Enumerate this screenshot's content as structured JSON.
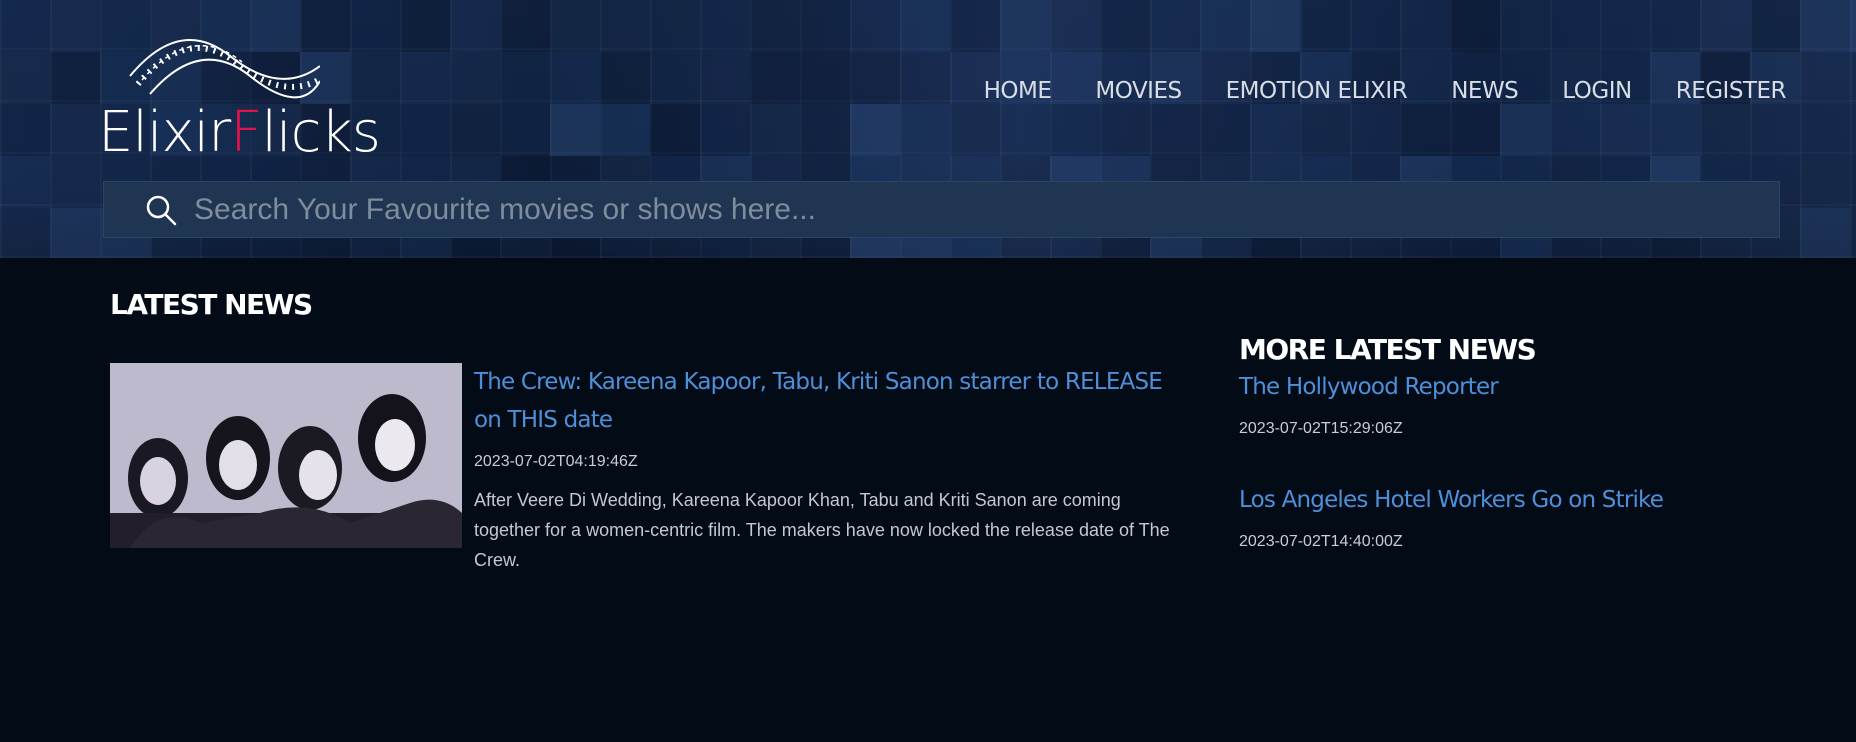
{
  "brand": {
    "part1": "Elixir",
    "accent": "F",
    "part2": "licks"
  },
  "nav": [
    {
      "label": "HOME"
    },
    {
      "label": "MOVIES"
    },
    {
      "label": "EMOTION ELIXIR"
    },
    {
      "label": "NEWS"
    },
    {
      "label": "LOGIN"
    },
    {
      "label": "REGISTER"
    }
  ],
  "search": {
    "placeholder": "Search Your Favourite movies or shows here...",
    "icon": "search-icon"
  },
  "latest": {
    "title": "LATEST NEWS",
    "article": {
      "headline": "The Crew: Kareena Kapoor, Tabu, Kriti Sanon starrer to RELEASE on THIS date",
      "date": "2023-07-02T04:19:46Z",
      "description": "After Veere Di Wedding, Kareena Kapoor Khan, Tabu and Kriti Sanon are coming together for a women-centric film. The makers have now locked the release date of The Crew."
    }
  },
  "more": {
    "title": "MORE LATEST NEWS",
    "items": [
      {
        "headline": "The Hollywood Reporter",
        "date": "2023-07-02T15:29:06Z"
      },
      {
        "headline": "Los Angeles Hotel Workers Go on Strike",
        "date": "2023-07-02T14:40:00Z"
      }
    ]
  },
  "colors": {
    "background": "#030b17",
    "link": "#4f8fd8",
    "brandAccent": "#e0134a",
    "searchBar": "#1f3551"
  }
}
